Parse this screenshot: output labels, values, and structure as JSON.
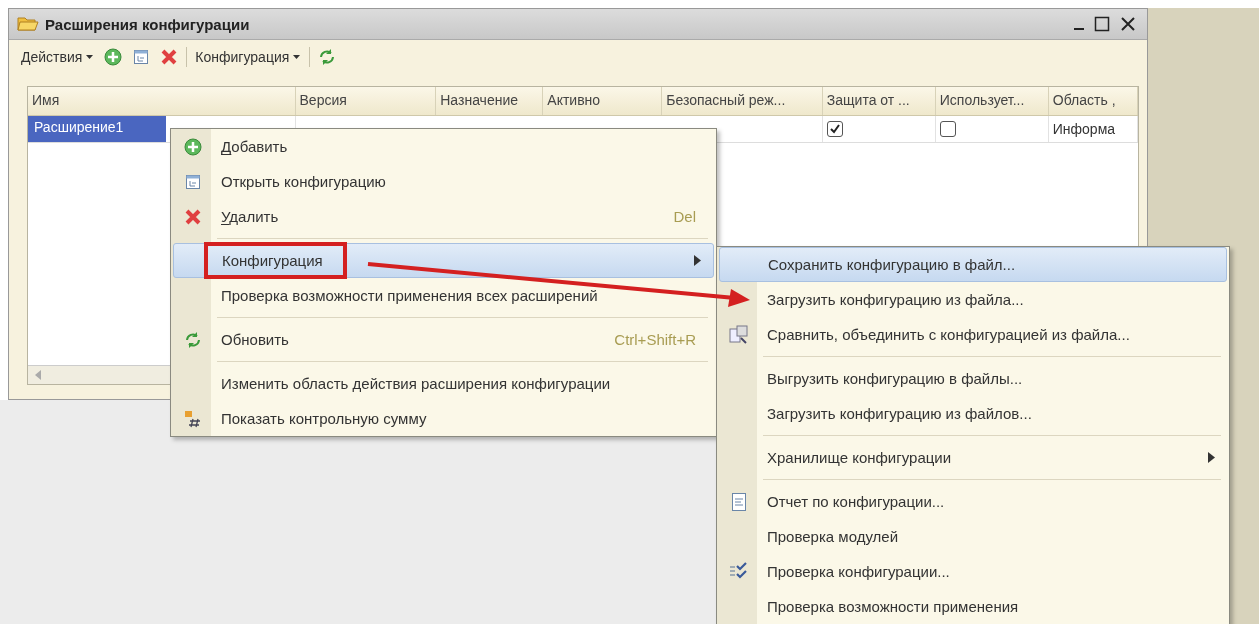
{
  "window": {
    "title": "Расширения конфигурации"
  },
  "toolbar": [
    {
      "kind": "dropdown",
      "label": "Действия"
    },
    {
      "kind": "icon"
    },
    {
      "kind": "icon"
    },
    {
      "kind": "icon"
    },
    {
      "kind": "separator"
    },
    {
      "kind": "dropdown",
      "label": "Конфигурация"
    },
    {
      "kind": "separator"
    },
    {
      "kind": "icon"
    }
  ],
  "table": {
    "columns": [
      "Имя",
      "Версия",
      "Назначение",
      "Активно",
      "Безопасный реж...",
      "Защита от ...",
      "Использует...",
      "Область ,"
    ],
    "rows": [
      {
        "selected": true,
        "name": "Расширение1",
        "protection": {
          "checked": true
        },
        "uses": {
          "checked": false
        },
        "area": "Информа"
      }
    ]
  },
  "context_menu": [
    {
      "kind": "item",
      "label": "Добавить",
      "mnemonic": true,
      "selected": false
    },
    {
      "kind": "item",
      "label": "Открыть конфигурацию",
      "mnemonic": false,
      "selected": false
    },
    {
      "kind": "item",
      "label": "Удалить",
      "mnemonic": true,
      "shortcut": "Del",
      "selected": false
    },
    {
      "kind": "separator"
    },
    {
      "kind": "item",
      "label": "Конфигурация",
      "mnemonic": false,
      "submenu": true,
      "selected": true
    },
    {
      "kind": "item",
      "label": "Проверка возможности применения всех расширений",
      "mnemonic": false,
      "selected": false
    },
    {
      "kind": "separator"
    },
    {
      "kind": "item",
      "label": "Обновить",
      "mnemonic": false,
      "shortcut": "Ctrl+Shift+R",
      "selected": false
    },
    {
      "kind": "separator"
    },
    {
      "kind": "item",
      "label": "Изменить область действия расширения конфигурации",
      "mnemonic": false,
      "selected": false
    },
    {
      "kind": "item",
      "label": "Показать контрольную сумму",
      "mnemonic": false,
      "selected": false
    }
  ],
  "submenu": [
    {
      "kind": "item",
      "label": "Сохранить конфигурацию в файл...",
      "selected": true
    },
    {
      "kind": "item",
      "label": "Загрузить конфигурацию из файла...",
      "selected": false
    },
    {
      "kind": "item",
      "label": "Сравнить, объединить с конфигурацией из файла...",
      "selected": false
    },
    {
      "kind": "separator"
    },
    {
      "kind": "item",
      "label": "Выгрузить конфигурацию в файлы...",
      "selected": false
    },
    {
      "kind": "item",
      "label": "Загрузить конфигурацию из файлов...",
      "selected": false
    },
    {
      "kind": "separator"
    },
    {
      "kind": "item",
      "label": "Хранилище конфигурации",
      "submenu": true,
      "selected": false
    },
    {
      "kind": "separator"
    },
    {
      "kind": "item",
      "label": "Отчет по конфигурации...",
      "selected": false
    },
    {
      "kind": "item",
      "label": "Проверка модулей",
      "selected": false
    },
    {
      "kind": "item",
      "label": "Проверка конфигурации...",
      "selected": false
    },
    {
      "kind": "item",
      "label": "Проверка возможности применения",
      "selected": false
    }
  ]
}
